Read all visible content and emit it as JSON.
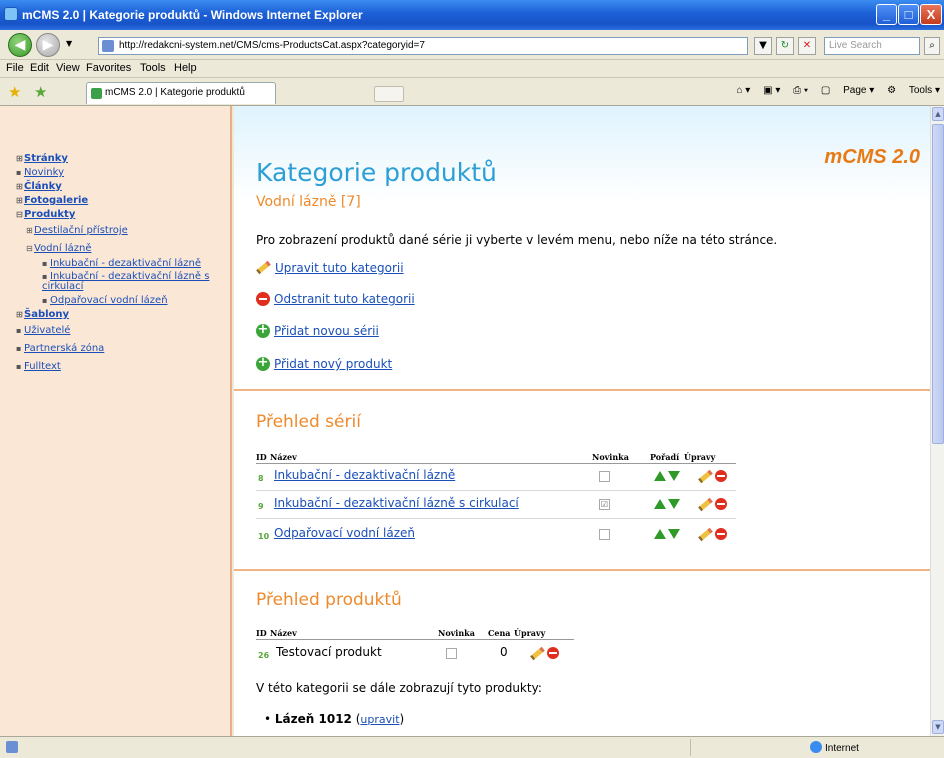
{
  "window": {
    "title": "mCMS 2.0 | Kategorie produktů - Windows Internet Explorer",
    "minimize": "_",
    "maximize": "□",
    "close": "X"
  },
  "browser": {
    "address": "http://redakcni-system.net/CMS/cms-ProductsCat.aspx?categoryid=7",
    "search_placeholder": "Live Search",
    "menu": [
      "File",
      "Edit",
      "View",
      "Favorites",
      "Tools",
      "Help"
    ],
    "tab_title": "mCMS 2.0 | Kategorie produktů",
    "cmd_page": "Page",
    "cmd_tools": "Tools",
    "status_zone": "Internet"
  },
  "sidebar": {
    "items": [
      {
        "label": "Stránky",
        "bold": true,
        "marker": "⊞"
      },
      {
        "label": "Novinky",
        "bold": false,
        "marker": "▪"
      },
      {
        "label": "Články",
        "bold": true,
        "marker": "⊞"
      },
      {
        "label": "Fotogalerie",
        "bold": true,
        "marker": "⊞"
      },
      {
        "label": "Produkty",
        "bold": true,
        "marker": "⊟"
      },
      {
        "label": "Destilační přístroje",
        "bold": false,
        "marker": "⊞"
      },
      {
        "label": "Vodní lázně",
        "bold": false,
        "marker": "⊟"
      },
      {
        "label": "Inkubační - dezaktivační lázně",
        "bold": false,
        "marker": "▪"
      },
      {
        "label": "Inkubační - dezaktivační lázně s cirkulací",
        "bold": false,
        "marker": "▪"
      },
      {
        "label": "Odpařovací vodní lázeň",
        "bold": false,
        "marker": "▪"
      },
      {
        "label": "Šablony",
        "bold": true,
        "marker": "⊞"
      },
      {
        "label": "Uživatelé",
        "bold": false,
        "marker": "▪"
      },
      {
        "label": "Partnerská zóna",
        "bold": false,
        "marker": "▪"
      },
      {
        "label": "Fulltext",
        "bold": false,
        "marker": "▪"
      }
    ]
  },
  "main": {
    "title": "Kategorie produktů",
    "logo": "mCMS 2.0",
    "subtitle": "Vodní lázně [7]",
    "intro": "Pro zobrazení produktů dané série ji vyberte v levém menu, nebo níže na této stránce.",
    "actions": {
      "edit": "Upravit tuto kategorii",
      "delete": "Odstranit tuto kategorii",
      "add_series": "Přidat novou sérii",
      "add_product": "Přidat nový produkt"
    },
    "series": {
      "title": "Přehled sérií",
      "headers": {
        "id": "ID",
        "name": "Název",
        "news": "Novinka",
        "order": "Pořadí",
        "edits": "Úpravy"
      },
      "rows": [
        {
          "id": "8",
          "name": "Inkubační - dezaktivační lázně",
          "news": ""
        },
        {
          "id": "9",
          "name": "Inkubační - dezaktivační lázně s cirkulací",
          "news": "☑"
        },
        {
          "id": "10",
          "name": "Odpařovací vodní lázeň",
          "news": ""
        }
      ]
    },
    "products": {
      "title": "Přehled produktů",
      "headers": {
        "id": "ID",
        "name": "Název",
        "news": "Novinka",
        "price": "Cena",
        "edits": "Úpravy"
      },
      "rows": [
        {
          "id": "26",
          "name": "Testovací produkt",
          "news": "",
          "price": "0"
        }
      ],
      "also_text": "V této kategorii se dále zobrazují tyto produkty:",
      "also_items": [
        {
          "name": "Lázeň 1012",
          "link": "upravit"
        }
      ]
    }
  }
}
